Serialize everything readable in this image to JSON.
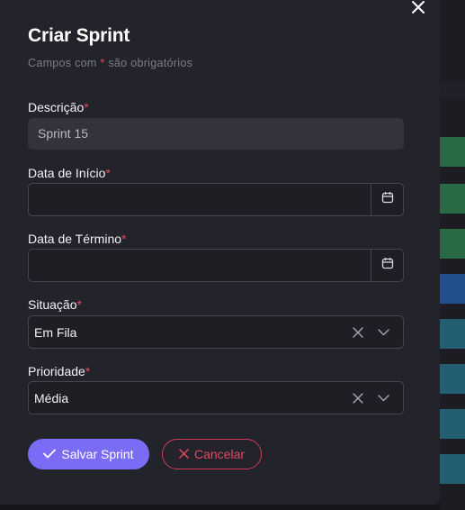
{
  "modal": {
    "title": "Criar Sprint",
    "subtitle_prefix": "Campos com",
    "subtitle_star": "*",
    "subtitle_suffix": "são obrigatórios",
    "close_icon": "close-icon"
  },
  "fields": {
    "descricao": {
      "label": "Descrição",
      "required": "*",
      "value": "Sprint 15"
    },
    "data_inicio": {
      "label": "Data de Início",
      "required": "*",
      "value": "",
      "icon": "calendar-icon"
    },
    "data_termino": {
      "label": "Data de Término",
      "required": "*",
      "value": "",
      "icon": "calendar-icon"
    },
    "situacao": {
      "label": "Situação",
      "required": "*",
      "value": "Em Fila"
    },
    "prioridade": {
      "label": "Prioridade",
      "required": "*",
      "value": "Média"
    }
  },
  "buttons": {
    "save_label": "Salvar Sprint",
    "cancel_label": "Cancelar"
  },
  "colors": {
    "accent": "#7b6cf6",
    "danger": "#e8475f",
    "modal_bg": "#23232b"
  }
}
